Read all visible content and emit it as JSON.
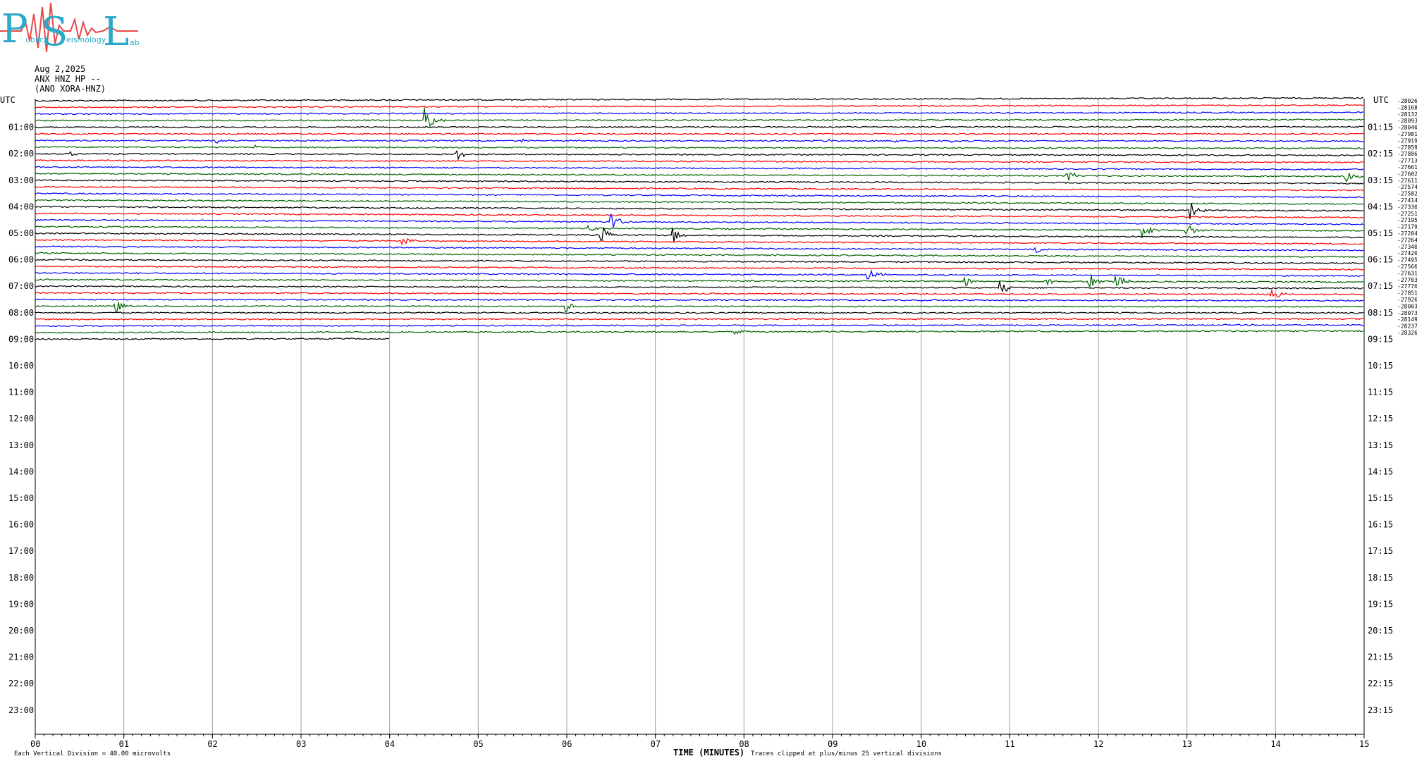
{
  "logo": {
    "big_letters": [
      "P",
      "S",
      "L"
    ],
    "small_text": [
      "ublic",
      "eismology",
      "ab"
    ]
  },
  "header": {
    "date": "Aug 2,2025",
    "station": "ANX HNZ HP --",
    "channel": "(ANO XORA-HNZ)"
  },
  "footer": {
    "scale_note": "Each Vertical Division =   40.00 microvolts",
    "xlabel": "TIME (MINUTES)",
    "clip_note": "Traces clipped at plus/minus 25 vertical divisions"
  },
  "colors": {
    "black": "#000000",
    "red": "#ff0000",
    "blue": "#0000ff",
    "green": "#006400",
    "grid": "#a0a0a0"
  },
  "chart_data": {
    "type": "line",
    "title": "",
    "xlabel": "TIME (MINUTES)",
    "xlim": [
      0,
      15
    ],
    "x_ticks": [
      "00",
      "01",
      "02",
      "03",
      "04",
      "05",
      "06",
      "07",
      "08",
      "09",
      "10",
      "11",
      "12",
      "13",
      "14",
      "15"
    ],
    "left_axis_label": "UTC",
    "right_axis_label": "UTC",
    "left_hour_labels": [
      "01:00",
      "02:00",
      "03:00",
      "04:00",
      "05:00",
      "06:00",
      "07:00",
      "08:00",
      "09:00",
      "10:00",
      "11:00",
      "12:00",
      "13:00",
      "14:00",
      "15:00",
      "16:00",
      "17:00",
      "18:00",
      "19:00",
      "20:00",
      "21:00",
      "22:00",
      "23:00"
    ],
    "right_hour_labels": [
      "01:15",
      "02:15",
      "03:15",
      "04:15",
      "05:15",
      "06:15",
      "07:15",
      "08:15",
      "09:15",
      "10:15",
      "11:15",
      "12:15",
      "13:15",
      "14:15",
      "15:15",
      "16:15",
      "17:15",
      "18:15",
      "19:15",
      "20:15",
      "21:15",
      "22:15",
      "23:15"
    ],
    "rows_per_hour": 4,
    "total_rows": 96,
    "trace_colors": [
      "black",
      "red",
      "blue",
      "green"
    ],
    "traces_plotted": 37,
    "last_trace_end_minute": 4.0,
    "offsets": [
      "-28026",
      "-28168",
      "-28132",
      "-28093",
      "-28040",
      "-27981",
      "-27919",
      "-27859",
      "-27886",
      "-27713",
      "-27661",
      "-27602",
      "-27611",
      "-27574",
      "-27582",
      "-27414",
      "-27330",
      "-27251",
      "-27195",
      "-27179",
      "-27204",
      "-27264",
      "-27340",
      "-27420",
      "-27495",
      "-27566",
      "-27631",
      "-27703",
      "-27776",
      "-27851",
      "-27926",
      "-28003",
      "-28073",
      "-28149",
      "-28237",
      "-28326"
    ],
    "events": [
      {
        "row": 3,
        "minute": 4.4,
        "amp": 22
      },
      {
        "row": 6,
        "minute": 2.05,
        "amp": 4
      },
      {
        "row": 6,
        "minute": 5.5,
        "amp": 3
      },
      {
        "row": 6,
        "minute": 8.9,
        "amp": 3
      },
      {
        "row": 6,
        "minute": 9.7,
        "amp": 3
      },
      {
        "row": 6,
        "minute": 10.35,
        "amp": 3
      },
      {
        "row": 7,
        "minute": 2.5,
        "amp": 3
      },
      {
        "row": 8,
        "minute": 0.4,
        "amp": 3
      },
      {
        "row": 8,
        "minute": 4.75,
        "amp": 10
      },
      {
        "row": 11,
        "minute": 11.65,
        "amp": 9
      },
      {
        "row": 11,
        "minute": 14.8,
        "amp": 9
      },
      {
        "row": 16,
        "minute": 13.05,
        "amp": 14
      },
      {
        "row": 18,
        "minute": 6.5,
        "amp": 14
      },
      {
        "row": 19,
        "minute": 6.25,
        "amp": 8
      },
      {
        "row": 19,
        "minute": 12.5,
        "amp": 12
      },
      {
        "row": 19,
        "minute": 13.0,
        "amp": 12
      },
      {
        "row": 20,
        "minute": 6.4,
        "amp": 14
      },
      {
        "row": 20,
        "minute": 7.2,
        "amp": 12
      },
      {
        "row": 21,
        "minute": 4.15,
        "amp": 10
      },
      {
        "row": 22,
        "minute": 11.3,
        "amp": 8
      },
      {
        "row": 26,
        "minute": 9.4,
        "amp": 14
      },
      {
        "row": 27,
        "minute": 10.5,
        "amp": 8
      },
      {
        "row": 27,
        "minute": 11.4,
        "amp": 8
      },
      {
        "row": 27,
        "minute": 11.9,
        "amp": 12
      },
      {
        "row": 27,
        "minute": 12.2,
        "amp": 16
      },
      {
        "row": 28,
        "minute": 10.9,
        "amp": 12
      },
      {
        "row": 29,
        "minute": 13.95,
        "amp": 12
      },
      {
        "row": 31,
        "minute": 0.9,
        "amp": 12
      },
      {
        "row": 31,
        "minute": 6.0,
        "amp": 8
      },
      {
        "row": 35,
        "minute": 7.9,
        "amp": 4
      }
    ]
  }
}
